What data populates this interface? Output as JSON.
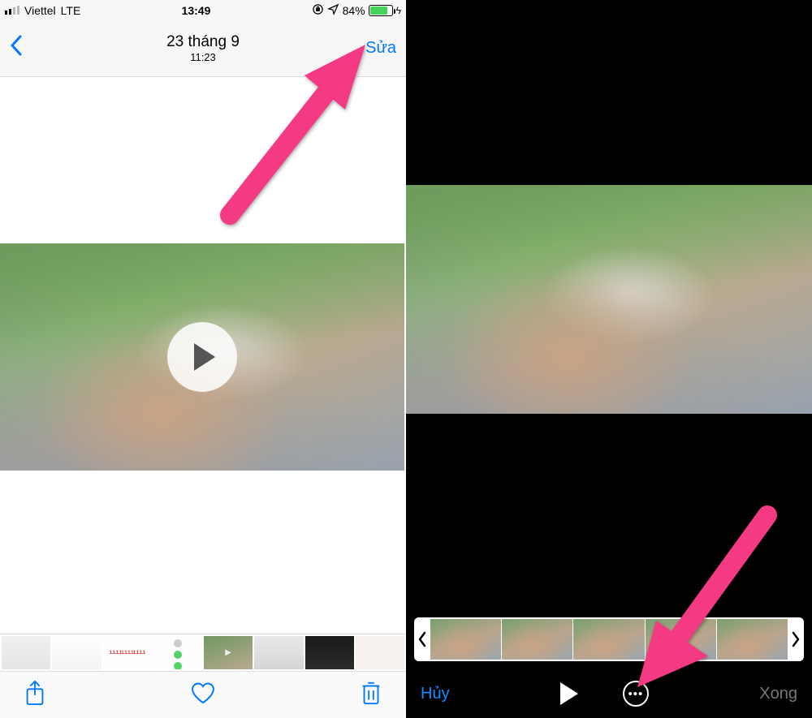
{
  "left": {
    "status": {
      "carrier": "Viettel",
      "network": "LTE",
      "time": "13:49",
      "battery_pct": "84%"
    },
    "nav": {
      "title": "23 tháng 9",
      "subtitle": "11:23",
      "edit": "Sửa"
    },
    "thumbs": {
      "t3": "1.1.1.11.1.1.11.1.1.1"
    }
  },
  "right": {
    "cancel": "Hủy",
    "done": "Xong",
    "more": "•••"
  }
}
